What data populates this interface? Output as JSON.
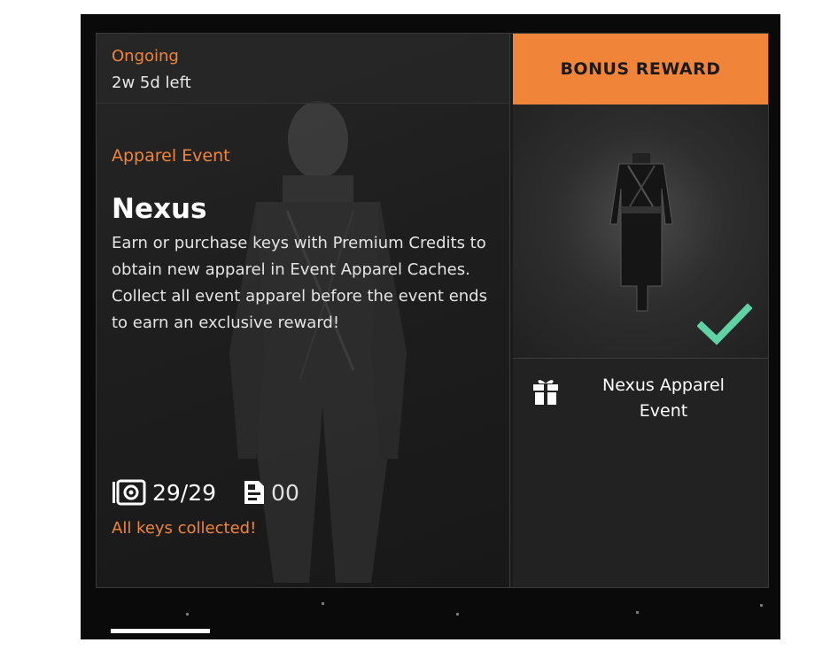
{
  "event": {
    "status_label": "Ongoing",
    "time_left": "2w 5d left",
    "type": "Apparel Event",
    "title": "Nexus",
    "description": "Earn or purchase keys with Premium Credits to obtain new apparel in Event Apparel Caches. Collect all event apparel before the event ends to earn an exclusive reward!"
  },
  "keys": {
    "collected": "29/29",
    "key_icon": "key-cache-icon",
    "credits": "00",
    "credits_icon": "premium-credits-icon",
    "status": "All keys collected!"
  },
  "bonus": {
    "header": "BONUS REWARD",
    "reward_name": "Nexus Apparel Event",
    "reward_icon": "gift-icon",
    "completed_icon": "checkmark-icon"
  },
  "colors": {
    "accent": "#f0853a",
    "check": "#5fd3a4",
    "panel": "#1b1b1b"
  }
}
